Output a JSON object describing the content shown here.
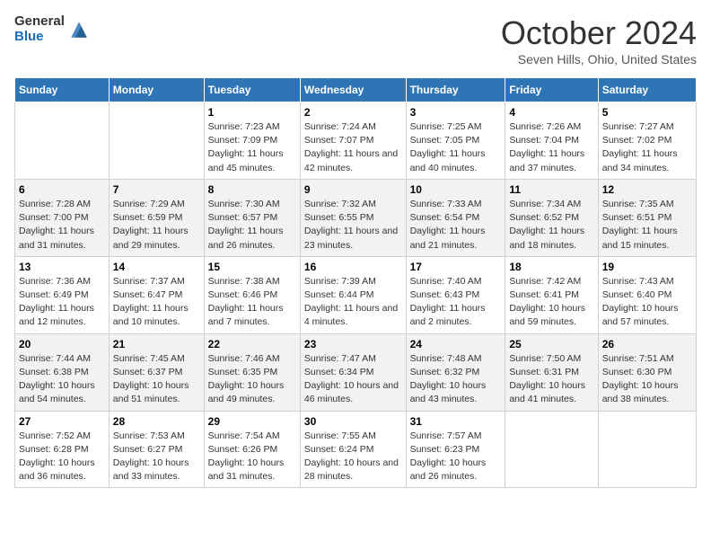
{
  "header": {
    "logo": {
      "general": "General",
      "blue": "Blue"
    },
    "title": "October 2024",
    "location": "Seven Hills, Ohio, United States"
  },
  "weekdays": [
    "Sunday",
    "Monday",
    "Tuesday",
    "Wednesday",
    "Thursday",
    "Friday",
    "Saturday"
  ],
  "weeks": [
    [
      {
        "day": "",
        "info": ""
      },
      {
        "day": "",
        "info": ""
      },
      {
        "day": "1",
        "info": "Sunrise: 7:23 AM\nSunset: 7:09 PM\nDaylight: 11 hours and 45 minutes."
      },
      {
        "day": "2",
        "info": "Sunrise: 7:24 AM\nSunset: 7:07 PM\nDaylight: 11 hours and 42 minutes."
      },
      {
        "day": "3",
        "info": "Sunrise: 7:25 AM\nSunset: 7:05 PM\nDaylight: 11 hours and 40 minutes."
      },
      {
        "day": "4",
        "info": "Sunrise: 7:26 AM\nSunset: 7:04 PM\nDaylight: 11 hours and 37 minutes."
      },
      {
        "day": "5",
        "info": "Sunrise: 7:27 AM\nSunset: 7:02 PM\nDaylight: 11 hours and 34 minutes."
      }
    ],
    [
      {
        "day": "6",
        "info": "Sunrise: 7:28 AM\nSunset: 7:00 PM\nDaylight: 11 hours and 31 minutes."
      },
      {
        "day": "7",
        "info": "Sunrise: 7:29 AM\nSunset: 6:59 PM\nDaylight: 11 hours and 29 minutes."
      },
      {
        "day": "8",
        "info": "Sunrise: 7:30 AM\nSunset: 6:57 PM\nDaylight: 11 hours and 26 minutes."
      },
      {
        "day": "9",
        "info": "Sunrise: 7:32 AM\nSunset: 6:55 PM\nDaylight: 11 hours and 23 minutes."
      },
      {
        "day": "10",
        "info": "Sunrise: 7:33 AM\nSunset: 6:54 PM\nDaylight: 11 hours and 21 minutes."
      },
      {
        "day": "11",
        "info": "Sunrise: 7:34 AM\nSunset: 6:52 PM\nDaylight: 11 hours and 18 minutes."
      },
      {
        "day": "12",
        "info": "Sunrise: 7:35 AM\nSunset: 6:51 PM\nDaylight: 11 hours and 15 minutes."
      }
    ],
    [
      {
        "day": "13",
        "info": "Sunrise: 7:36 AM\nSunset: 6:49 PM\nDaylight: 11 hours and 12 minutes."
      },
      {
        "day": "14",
        "info": "Sunrise: 7:37 AM\nSunset: 6:47 PM\nDaylight: 11 hours and 10 minutes."
      },
      {
        "day": "15",
        "info": "Sunrise: 7:38 AM\nSunset: 6:46 PM\nDaylight: 11 hours and 7 minutes."
      },
      {
        "day": "16",
        "info": "Sunrise: 7:39 AM\nSunset: 6:44 PM\nDaylight: 11 hours and 4 minutes."
      },
      {
        "day": "17",
        "info": "Sunrise: 7:40 AM\nSunset: 6:43 PM\nDaylight: 11 hours and 2 minutes."
      },
      {
        "day": "18",
        "info": "Sunrise: 7:42 AM\nSunset: 6:41 PM\nDaylight: 10 hours and 59 minutes."
      },
      {
        "day": "19",
        "info": "Sunrise: 7:43 AM\nSunset: 6:40 PM\nDaylight: 10 hours and 57 minutes."
      }
    ],
    [
      {
        "day": "20",
        "info": "Sunrise: 7:44 AM\nSunset: 6:38 PM\nDaylight: 10 hours and 54 minutes."
      },
      {
        "day": "21",
        "info": "Sunrise: 7:45 AM\nSunset: 6:37 PM\nDaylight: 10 hours and 51 minutes."
      },
      {
        "day": "22",
        "info": "Sunrise: 7:46 AM\nSunset: 6:35 PM\nDaylight: 10 hours and 49 minutes."
      },
      {
        "day": "23",
        "info": "Sunrise: 7:47 AM\nSunset: 6:34 PM\nDaylight: 10 hours and 46 minutes."
      },
      {
        "day": "24",
        "info": "Sunrise: 7:48 AM\nSunset: 6:32 PM\nDaylight: 10 hours and 43 minutes."
      },
      {
        "day": "25",
        "info": "Sunrise: 7:50 AM\nSunset: 6:31 PM\nDaylight: 10 hours and 41 minutes."
      },
      {
        "day": "26",
        "info": "Sunrise: 7:51 AM\nSunset: 6:30 PM\nDaylight: 10 hours and 38 minutes."
      }
    ],
    [
      {
        "day": "27",
        "info": "Sunrise: 7:52 AM\nSunset: 6:28 PM\nDaylight: 10 hours and 36 minutes."
      },
      {
        "day": "28",
        "info": "Sunrise: 7:53 AM\nSunset: 6:27 PM\nDaylight: 10 hours and 33 minutes."
      },
      {
        "day": "29",
        "info": "Sunrise: 7:54 AM\nSunset: 6:26 PM\nDaylight: 10 hours and 31 minutes."
      },
      {
        "day": "30",
        "info": "Sunrise: 7:55 AM\nSunset: 6:24 PM\nDaylight: 10 hours and 28 minutes."
      },
      {
        "day": "31",
        "info": "Sunrise: 7:57 AM\nSunset: 6:23 PM\nDaylight: 10 hours and 26 minutes."
      },
      {
        "day": "",
        "info": ""
      },
      {
        "day": "",
        "info": ""
      }
    ]
  ]
}
